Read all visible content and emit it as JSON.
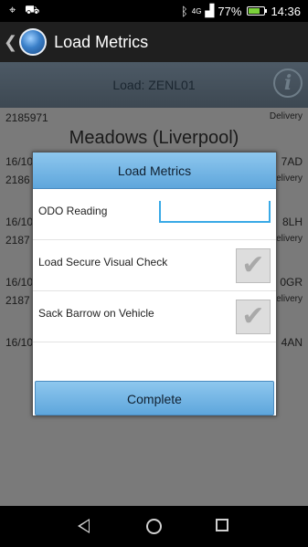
{
  "status_bar": {
    "left_icons": [
      "location-icon",
      "car-icon"
    ],
    "network": "4G",
    "battery_percent": "77%",
    "battery_level": 0.77,
    "time": "14:36"
  },
  "action_bar": {
    "back_glyph": "❮",
    "title": "Load Metrics"
  },
  "background": {
    "load_title": "Load: ZENL01",
    "info_glyph": "i",
    "first_row": {
      "id": "2185971",
      "type": "Delivery"
    },
    "location": "Meadows (Liverpool)",
    "partial_rows": [
      {
        "left": "16/10",
        "right": "7AD"
      },
      {
        "left": "2186",
        "right": "Delivery"
      },
      {
        "left": "16/10",
        "right": "8LH"
      },
      {
        "left": "2187",
        "right": "Delivery"
      },
      {
        "left": "16/10",
        "right": "0GR"
      },
      {
        "left": "2187",
        "right": "Delivery"
      },
      {
        "left": "16/10",
        "right": "4AN"
      }
    ]
  },
  "dialog": {
    "title": "Load Metrics",
    "odo_label": "ODO Reading",
    "odo_value": "",
    "check1_label": "Load Secure Visual Check",
    "check1_checked": true,
    "check2_label": "Sack Barrow on Vehicle",
    "check2_checked": true,
    "check_glyph": "✔",
    "complete_label": "Complete"
  },
  "colors": {
    "accent": "#5ea6dc",
    "input_underline": "#39a9e6",
    "battery_fill": "#7ad13a"
  }
}
